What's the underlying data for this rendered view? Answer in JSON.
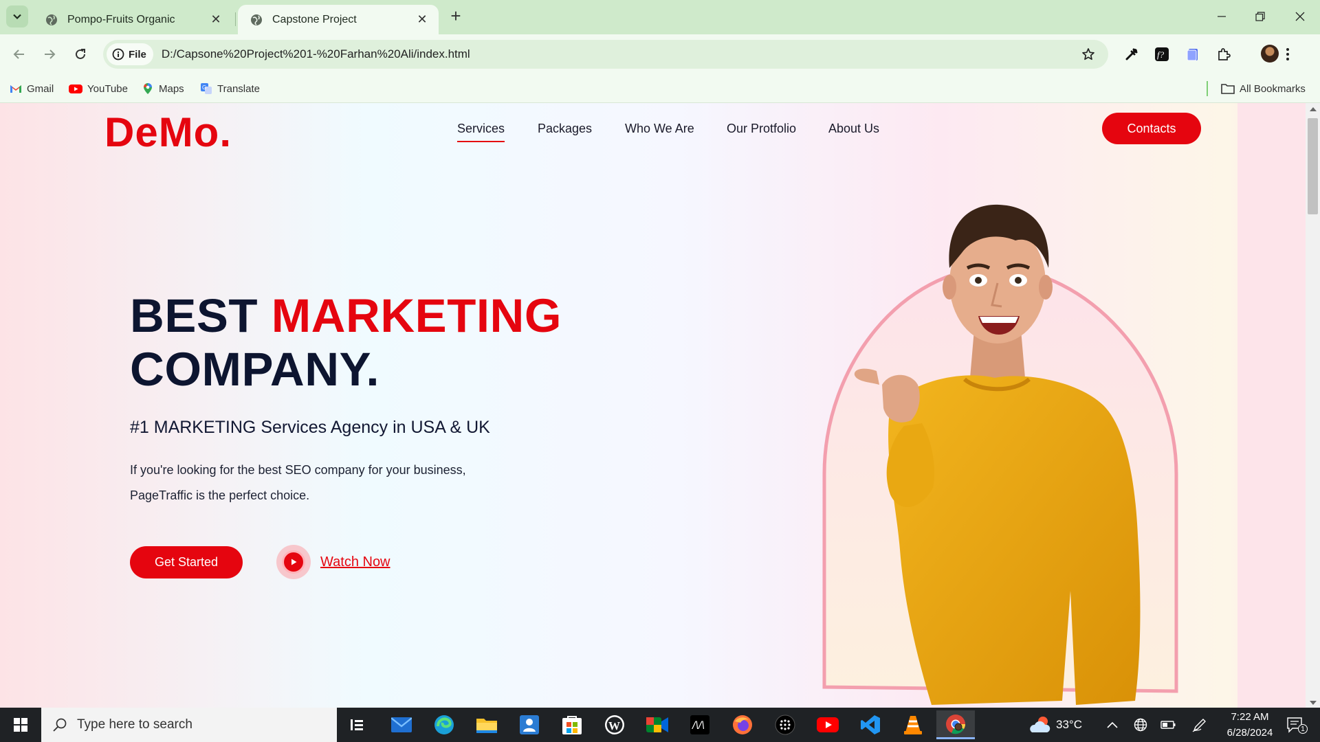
{
  "browser": {
    "tabs": [
      {
        "title": "Pompo-Fruits Organic",
        "active": false
      },
      {
        "title": "Capstone Project",
        "active": true
      }
    ],
    "address": {
      "chip_label": "File",
      "url": "D:/Capsone%20Project%201-%20Farhan%20Ali/index.html"
    },
    "bookmarks": [
      {
        "label": "Gmail",
        "icon": "gmail-icon"
      },
      {
        "label": "YouTube",
        "icon": "youtube-icon"
      },
      {
        "label": "Maps",
        "icon": "maps-icon"
      },
      {
        "label": "Translate",
        "icon": "translate-icon"
      }
    ],
    "all_bookmarks_label": "All Bookmarks"
  },
  "site": {
    "logo": "DeMo.",
    "nav": [
      {
        "label": "Services",
        "active": true
      },
      {
        "label": "Packages",
        "active": false
      },
      {
        "label": "Who We Are",
        "active": false
      },
      {
        "label": "Our Protfolio",
        "active": false
      },
      {
        "label": "About Us",
        "active": false
      }
    ],
    "contacts_label": "Contacts",
    "hero": {
      "title_part1": "BEST ",
      "title_accent": "MARKETING",
      "title_part2": "COMPANY.",
      "subtitle": "#1 MARKETING Services Agency in USA & UK",
      "paragraph_line1": "If you're looking for the best SEO company for your business,",
      "paragraph_line2": "PageTraffic is the perfect choice.",
      "cta_label": "Get Started",
      "watch_label": "Watch Now"
    },
    "colors": {
      "accent": "#e5050f",
      "heading": "#0d1530"
    }
  },
  "taskbar": {
    "search_placeholder": "Type here to search",
    "weather": "33°C",
    "time": "7:22 AM",
    "date": "6/28/2024",
    "notification_count": "1"
  }
}
